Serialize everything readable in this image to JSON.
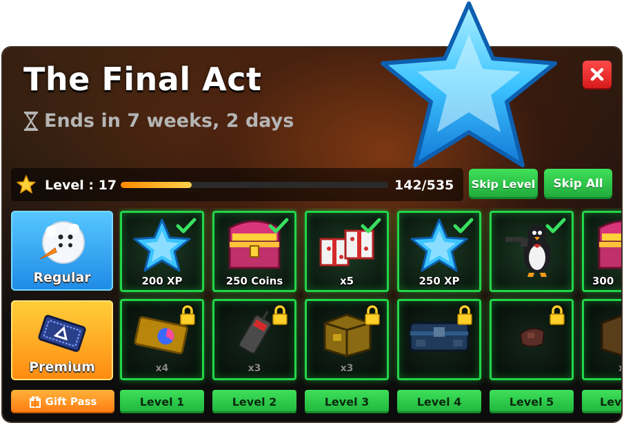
{
  "event": {
    "title": "The Final Act",
    "ends_text": "Ends in 7 weeks, 2 days"
  },
  "progress": {
    "level_text": "Level : 17",
    "xp_text": "142/535",
    "fill_fraction": 0.265
  },
  "buttons": {
    "skip_level": "Skip Level",
    "skip_all": "Skip All",
    "gift_pass": "Gift Pass"
  },
  "tracks": {
    "regular": "Regular",
    "premium": "Premium"
  },
  "regular_rewards": [
    {
      "label": "200 XP",
      "icon": "star-icon",
      "claimed": true
    },
    {
      "label": "250 Coins",
      "icon": "treasure-chest-icon",
      "claimed": true
    },
    {
      "label": "x5",
      "icon": "gift-boxes-icon",
      "claimed": true
    },
    {
      "label": "250 XP",
      "icon": "star-icon",
      "claimed": true
    },
    {
      "label": "",
      "icon": "penguin-gunner-icon",
      "claimed": true
    },
    {
      "label": "300",
      "icon": "treasure-chest-icon",
      "claimed": false
    }
  ],
  "premium_rewards": [
    {
      "qty": "x4",
      "icon": "ticket-icon",
      "locked": true
    },
    {
      "qty": "x3",
      "icon": "walkie-talkie-icon",
      "locked": true
    },
    {
      "qty": "x3",
      "icon": "crate-icon",
      "locked": true
    },
    {
      "qty": "",
      "icon": "armored-case-icon",
      "locked": true
    },
    {
      "qty": "",
      "icon": "bracelet-icon",
      "locked": true
    },
    {
      "qty": "x",
      "icon": "crate-icon",
      "locked": false
    }
  ],
  "levels": [
    "Level 1",
    "Level 2",
    "Level 3",
    "Level 4",
    "Level 5",
    "Lev"
  ],
  "colors": {
    "accent_green": "#22d64a",
    "close_red": "#e52222",
    "progress_orange": "#ff8a00"
  }
}
